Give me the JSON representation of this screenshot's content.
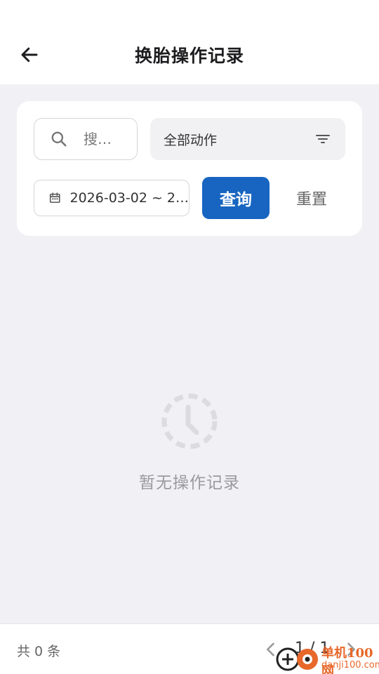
{
  "header": {
    "title": "换胎操作记录",
    "back_icon": "arrow-left-icon"
  },
  "filters": {
    "search": {
      "value": "",
      "placeholder": "搜…",
      "icon": "search-icon"
    },
    "action_select": {
      "selected": "全部动作",
      "icon": "filter-icon"
    },
    "date_range": {
      "value": "2026-03-02 ~ 2…",
      "icon": "calendar-icon"
    },
    "query_label": "查询",
    "reset_label": "重置"
  },
  "empty_state": {
    "icon": "clock-icon",
    "text": "暂无操作记录"
  },
  "footer": {
    "total_text": "共 0 条",
    "page_indicator": "1 / 1"
  },
  "watermark": {
    "line1": "单机100网",
    "line2": "danji100.com"
  },
  "colors": {
    "primary": "#1765c1",
    "watermark": "#e8672a",
    "background": "#f1f1f5"
  }
}
